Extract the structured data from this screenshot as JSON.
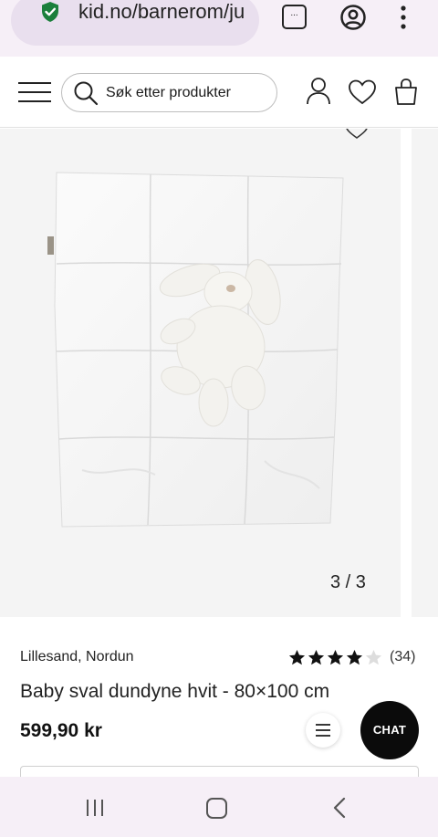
{
  "browser": {
    "url": "kid.no/barnerom/ju",
    "tab_count": "...",
    "icons": [
      "shield-check-icon",
      "account-circle-icon",
      "more-vert-icon"
    ]
  },
  "header": {
    "search_placeholder": "Søk etter produkter",
    "icons": [
      "hamburger-menu-icon",
      "search-icon",
      "user-icon",
      "heart-icon",
      "shopping-bag-icon"
    ]
  },
  "gallery": {
    "counter": "3 / 3",
    "current_index": 3,
    "total": 3
  },
  "product": {
    "brand": "Lillesand, Nordun",
    "rating": 4,
    "rating_max": 5,
    "rating_count": "(34)",
    "title": "Baby sval dundyne hvit - 80×100 cm",
    "price": "599,90 kr"
  },
  "actions": {
    "chat_label": "CHAT"
  },
  "colors": {
    "shield_green": "#1b7f3b",
    "chat_bg": "#0b0b0b",
    "bar_bg": "#f6eff7"
  }
}
